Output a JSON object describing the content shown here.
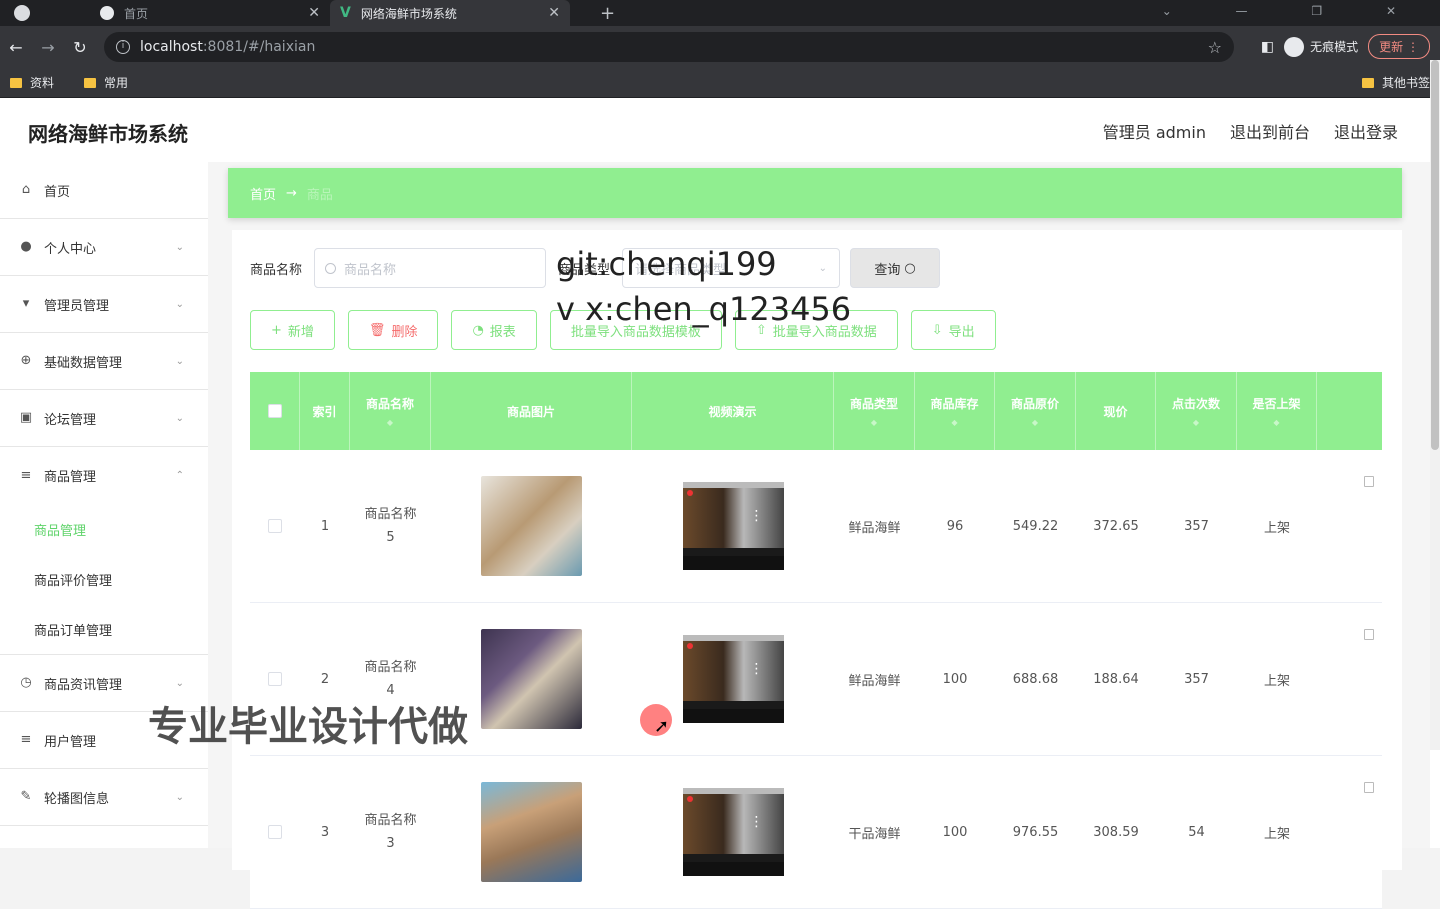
{
  "browser": {
    "tabs": [
      {
        "title": "首页",
        "active": false
      },
      {
        "title": "网络海鲜市场系统",
        "active": true
      }
    ],
    "url_host": "localhost",
    "url_rest": ":8081/#/haixian",
    "incognito_label": "无痕模式",
    "update_label": "更新",
    "bookmarks": [
      "资料",
      "常用"
    ],
    "other_bookmarks": "其他书签"
  },
  "header": {
    "brand": "网络海鲜市场系统",
    "links": [
      "管理员 admin",
      "退出到前台",
      "退出登录"
    ]
  },
  "sidebar": {
    "items": [
      {
        "label": "首页",
        "icon": "home-icon",
        "glyph": "⌂",
        "expandable": false
      },
      {
        "label": "个人中心",
        "icon": "user-icon",
        "glyph": "👤",
        "expandable": true
      },
      {
        "label": "管理员管理",
        "icon": "admin-icon",
        "glyph": "▾",
        "expandable": true
      },
      {
        "label": "基础数据管理",
        "icon": "data-icon",
        "glyph": "⊕",
        "expandable": true
      },
      {
        "label": "论坛管理",
        "icon": "forum-icon",
        "glyph": "▣",
        "expandable": true
      },
      {
        "label": "商品管理",
        "icon": "list-icon",
        "glyph": "≡",
        "expandable": true,
        "expanded": true
      },
      {
        "label": "商品资讯管理",
        "icon": "clock-icon",
        "glyph": "◷",
        "expandable": true
      },
      {
        "label": "用户管理",
        "icon": "list-icon",
        "glyph": "≡",
        "expandable": false
      },
      {
        "label": "轮播图信息",
        "icon": "edit-icon",
        "glyph": "✎",
        "expandable": true
      }
    ],
    "sub_items": [
      "商品管理",
      "商品评价管理",
      "商品订单管理"
    ],
    "active_sub": "商品管理"
  },
  "breadcrumb": {
    "home": "首页",
    "arrow": "→",
    "current": "商品"
  },
  "search": {
    "name_label": "商品名称",
    "name_placeholder": "商品名称",
    "type_label": "商品类型",
    "type_placeholder": "请选择商品类型",
    "query_label": "查询"
  },
  "actions": {
    "add": "新增",
    "delete": "删除",
    "report": "报表",
    "download_template": "批量导入商品数据模板",
    "batch_import": "批量导入商品数据",
    "export": "导出"
  },
  "table": {
    "headers": [
      "索引",
      "商品名称",
      "商品图片",
      "视频演示",
      "商品类型",
      "商品库存",
      "商品原价",
      "现价",
      "点击次数",
      "是否上架"
    ],
    "rows": [
      {
        "index": "1",
        "name_line1": "商品名称",
        "name_line2": "5",
        "type": "鲜品海鲜",
        "stock": "96",
        "original_price": "549.22",
        "price": "372.65",
        "clicks": "357",
        "status": "上架",
        "img_color": "#c9b8a0"
      },
      {
        "index": "2",
        "name_line1": "商品名称",
        "name_line2": "4",
        "type": "鲜品海鲜",
        "stock": "100",
        "original_price": "688.68",
        "price": "188.64",
        "clicks": "357",
        "status": "上架",
        "img_color": "#5a4a6a"
      },
      {
        "index": "3",
        "name_line1": "商品名称",
        "name_line2": "3",
        "type": "干品海鲜",
        "stock": "100",
        "original_price": "976.55",
        "price": "308.59",
        "clicks": "54",
        "status": "上架",
        "img_color": "#b89a70"
      }
    ]
  },
  "watermarks": [
    "git:chenqi199",
    "v x:chen_q123456",
    "专业毕业设计代做"
  ],
  "colors": {
    "accent": "#90ee90",
    "accent_text": "#5fd36a",
    "danger": "#f56c6c"
  }
}
